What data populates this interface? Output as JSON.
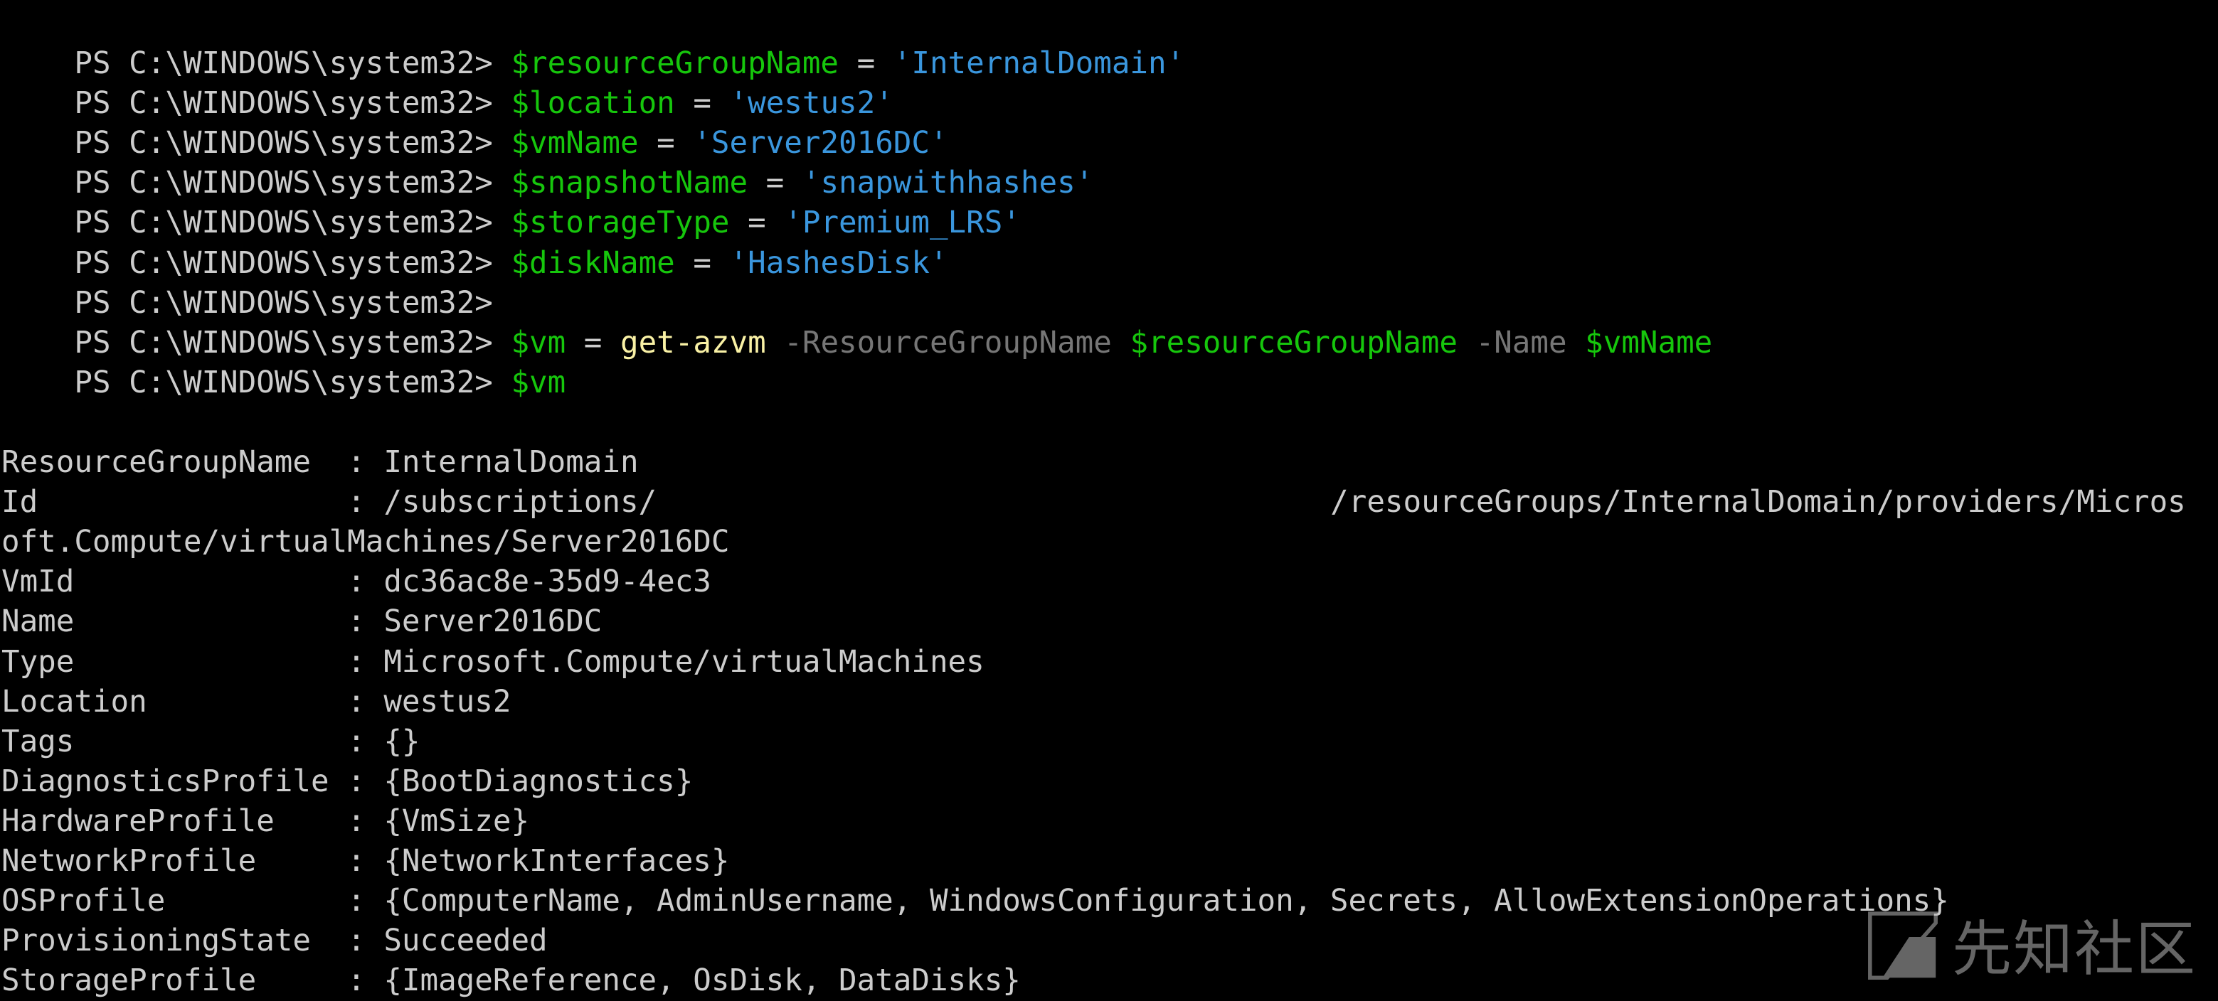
{
  "window": {
    "background": "#000000"
  },
  "colors": {
    "prompt": "#cccccc",
    "variable": "#16c60c",
    "string": "#3a96dd",
    "command": "#f9f1a5",
    "parameter": "#767676",
    "output": "#cccccc"
  },
  "prompt": "PS C:\\WINDOWS\\system32> ",
  "commands": {
    "c1": {
      "var": "$resourceGroupName",
      "op": " = ",
      "value": "'InternalDomain'"
    },
    "c2": {
      "var": "$location",
      "op": " = ",
      "value": "'westus2'"
    },
    "c3": {
      "var": "$vmName",
      "op": " = ",
      "value": "'Server2016DC'"
    },
    "c4": {
      "var": "$snapshotName",
      "op": " = ",
      "value": "'snapwithhashes'"
    },
    "c5": {
      "var": "$storageType",
      "op": " = ",
      "value": "'Premium_LRS'"
    },
    "c6": {
      "var": "$diskName",
      "op": " = ",
      "value": "'HashesDisk'"
    },
    "c8": {
      "var": "$vm",
      "op": " = ",
      "cmdlet": "get-azvm",
      "param1": " -ResourceGroupName ",
      "arg1": "$resourceGroupName",
      "param2": " -Name ",
      "arg2": "$vmName"
    },
    "c9": {
      "var": "$vm"
    }
  },
  "output": {
    "ResourceGroupName": "ResourceGroupName  : InternalDomain",
    "Id_part1": "Id                 : /subscriptions/",
    "Id_part2": "/resourceGroups/InternalDomain/providers/Micros",
    "Id_wrap": "oft.Compute/virtualMachines/Server2016DC",
    "VmId": "VmId               : dc36ac8e-35d9-4ec3",
    "Name": "Name               : Server2016DC",
    "Type": "Type               : Microsoft.Compute/virtualMachines",
    "Location": "Location           : westus2",
    "Tags": "Tags               : {}",
    "DiagnosticsProfile": "DiagnosticsProfile : {BootDiagnostics}",
    "HardwareProfile": "HardwareProfile    : {VmSize}",
    "NetworkProfile": "NetworkProfile     : {NetworkInterfaces}",
    "OSProfile": "OSProfile          : {ComputerName, AdminUsername, WindowsConfiguration, Secrets, AllowExtensionOperations}",
    "ProvisioningState": "ProvisioningState  : Succeeded",
    "StorageProfile": "StorageProfile     : {ImageReference, OsDisk, DataDisks}"
  },
  "watermark": {
    "icon": "xianzhi-logo-icon",
    "text": "先知社区"
  }
}
